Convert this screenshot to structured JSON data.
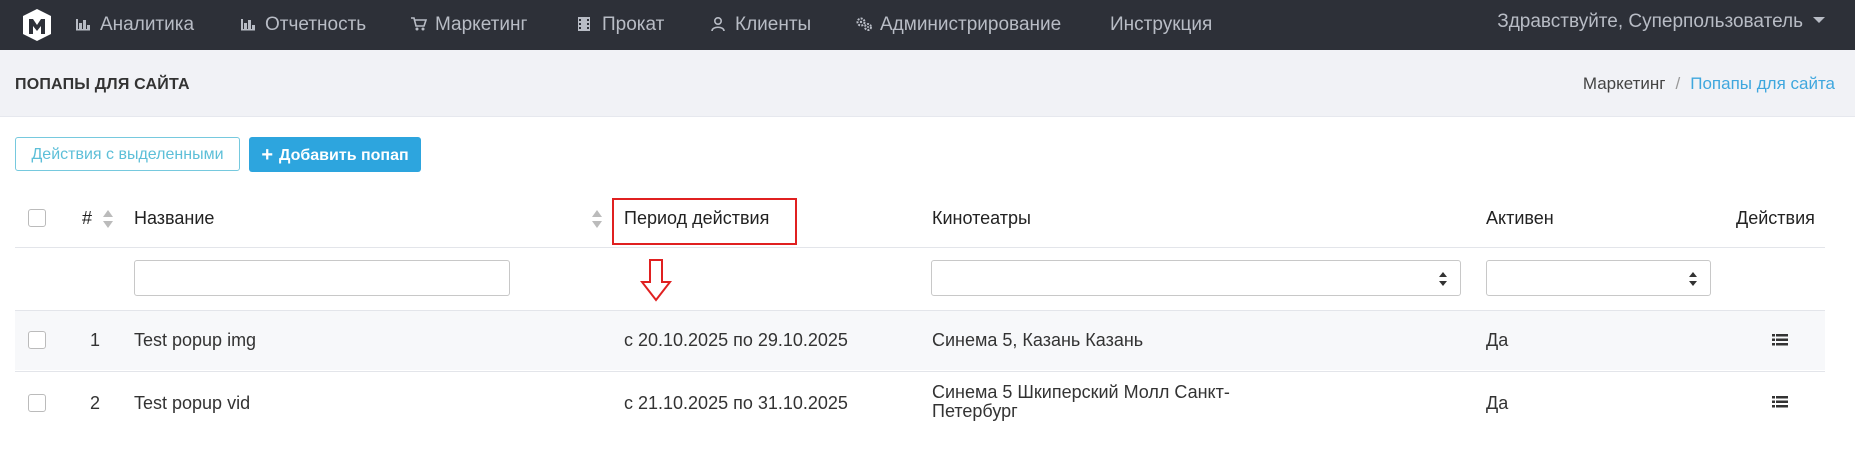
{
  "nav": {
    "items": [
      {
        "label": "Аналитика",
        "icon": "bar-chart-icon"
      },
      {
        "label": "Отчетность",
        "icon": "bar-chart-icon"
      },
      {
        "label": "Маркетинг",
        "icon": "cart-icon"
      },
      {
        "label": "Прокат",
        "icon": "film-icon"
      },
      {
        "label": "Клиенты",
        "icon": "user-icon"
      },
      {
        "label": "Администрирование",
        "icon": "gears-icon"
      },
      {
        "label": "Инструкция",
        "icon": ""
      }
    ],
    "user_greeting": "Здравствуйте, Суперпользователь"
  },
  "page": {
    "title": "ПОПАПЫ ДЛЯ САЙТА",
    "breadcrumb": [
      "Маркетинг",
      "Попапы для сайта"
    ]
  },
  "toolbar": {
    "bulk_actions_label": "Действия с выделенными",
    "add_label": "Добавить попап"
  },
  "table": {
    "columns": [
      "#",
      "Название",
      "Период действия",
      "Кинотеатры",
      "Активен",
      "Действия"
    ],
    "rows": [
      {
        "id": "1",
        "name": "Test popup img",
        "period": "с 20.10.2025 по 29.10.2025",
        "cinemas": "Синема 5, Казань Казань",
        "active": "Да"
      },
      {
        "id": "2",
        "name": "Test popup vid",
        "period": "с 21.10.2025 по 31.10.2025",
        "cinemas": "Синема 5 Шкиперский Молл Санкт-Петербург",
        "active": "Да"
      }
    ]
  },
  "colors": {
    "navbar": "#2d3038",
    "accent": "#2da5de",
    "annotation": "#e02020"
  }
}
